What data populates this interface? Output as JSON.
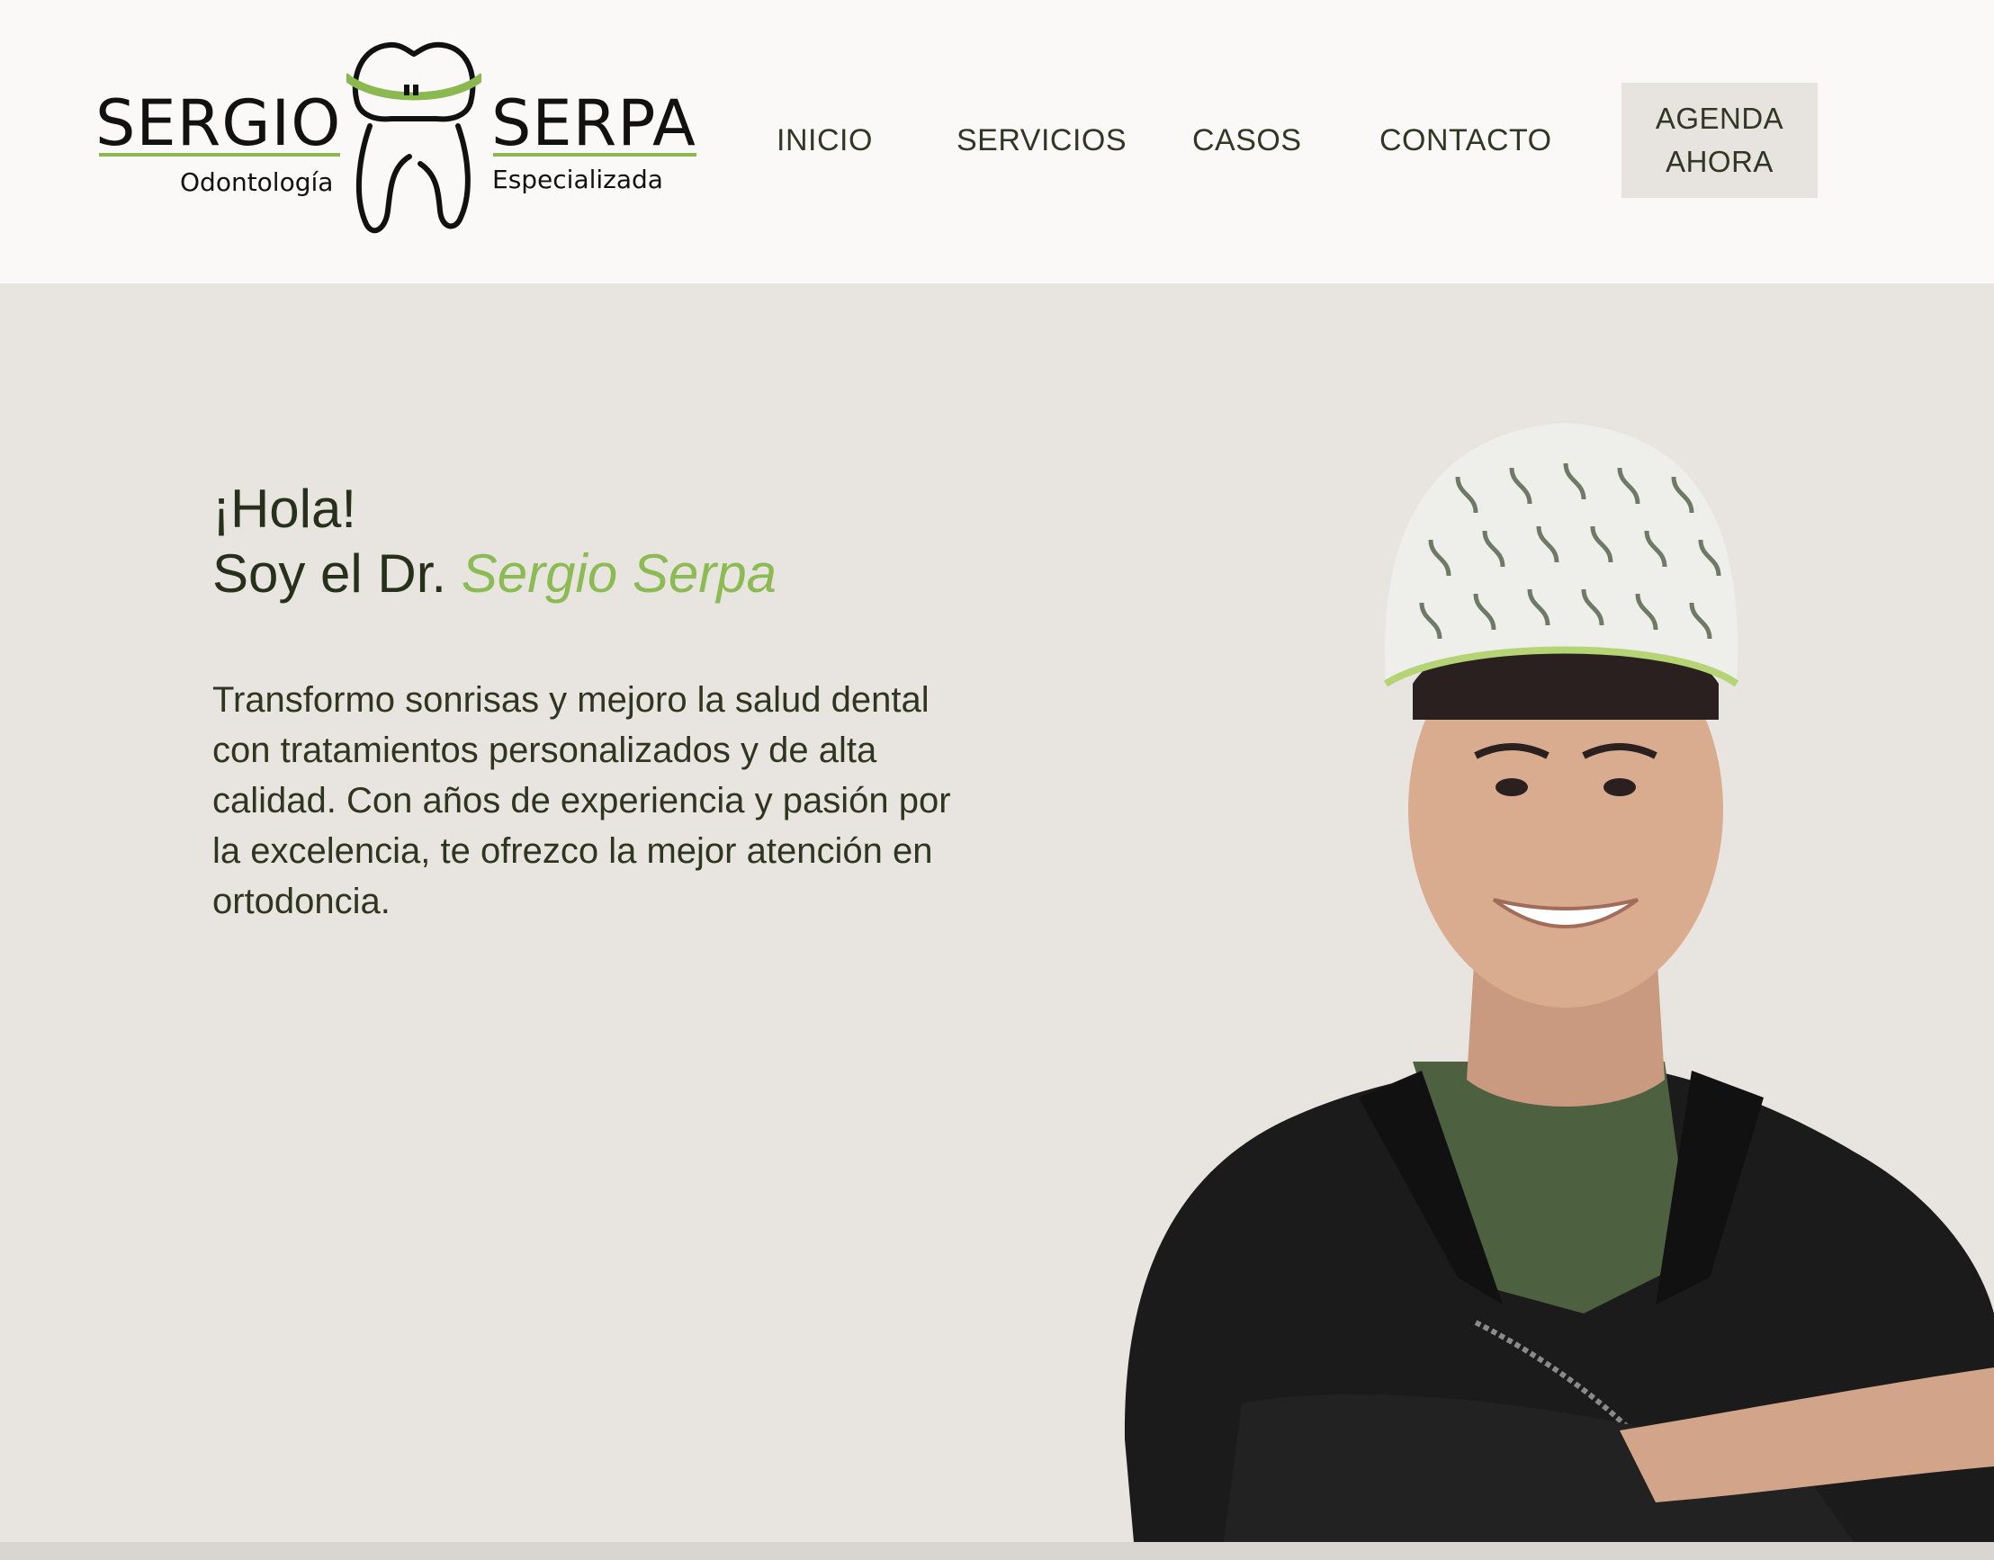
{
  "brand": {
    "first_name": "SERGIO",
    "last_name": "SERPA",
    "subtitle_left": "Odontología",
    "subtitle_right": "Especializada",
    "accent_color": "#8bb84f"
  },
  "nav": {
    "items": [
      {
        "label": "INICIO"
      },
      {
        "label": "SERVICIOS"
      },
      {
        "label": "CASOS"
      },
      {
        "label": "CONTACTO"
      }
    ],
    "cta_line1": "AGENDA",
    "cta_line2": "AHORA"
  },
  "hero": {
    "line1": "¡Hola!",
    "line2_prefix": "Soy el Dr. ",
    "line2_name": "Sergio Serpa",
    "intro": "Transformo sonrisas y mejoro la salud dental con tratamientos personalizados y de alta calidad. Con años de experiencia y pasión por la excelencia, te ofrezco la mejor atención en ortodoncia.",
    "photo_icon": "doctor-portrait"
  },
  "colors": {
    "header_bg": "#faf9f7",
    "page_bg": "#e8e5e1",
    "text": "#2f3420",
    "highlight": "#8cba53"
  }
}
